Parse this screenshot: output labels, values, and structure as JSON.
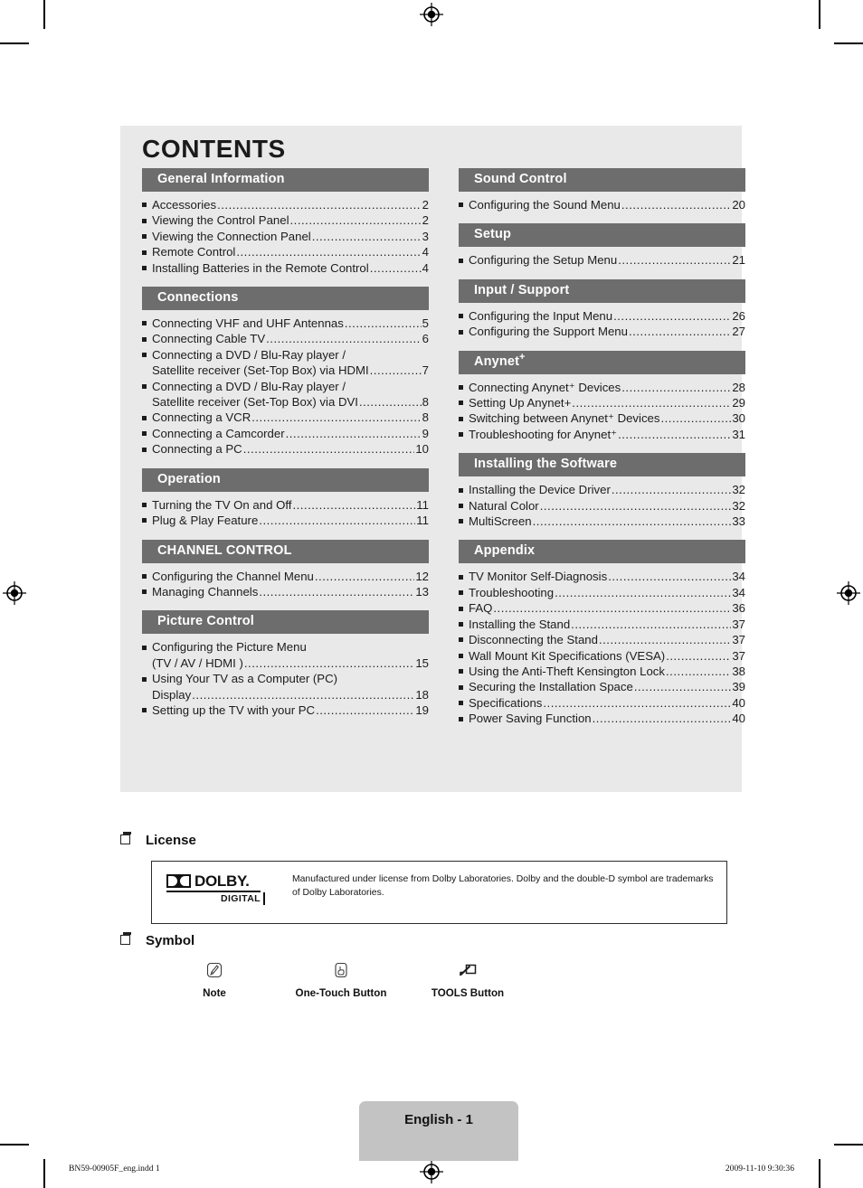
{
  "document": {
    "contents_title": "CONTENTS",
    "page_label": "English - 1",
    "footer_left": "BN59-00905F_eng.indd   1",
    "footer_right": "2009-11-10   9:30:36"
  },
  "colors": {
    "panel_bg": "#e9e9e9",
    "section_bar": "#6d6d6d",
    "section_bar_text": "#ffffff",
    "page_badge": "#c3c3c3",
    "text": "#1c1c1c"
  },
  "toc": {
    "left_column": [
      {
        "heading": "General Information",
        "heading_sup": "",
        "entries": [
          {
            "text": "Accessories",
            "page": "2"
          },
          {
            "text": "Viewing the Control Panel",
            "page": "2"
          },
          {
            "text": "Viewing the Connection Panel",
            "page": "3"
          },
          {
            "text": "Remote Control",
            "page": "4"
          },
          {
            "text": "Installing Batteries in the Remote Control",
            "page": "4"
          }
        ]
      },
      {
        "heading": "Connections",
        "heading_sup": "",
        "entries": [
          {
            "text": "Connecting VHF and UHF Antennas",
            "page": "5"
          },
          {
            "text": "Connecting Cable TV",
            "page": "6"
          },
          {
            "text": "Connecting a DVD / Blu-Ray player /",
            "page": "",
            "nodots": true
          },
          {
            "text": "Satellite receiver (Set-Top Box) via HDMI",
            "page": "7",
            "cont": true
          },
          {
            "text": "Connecting a DVD / Blu-Ray player /",
            "page": "",
            "nodots": true
          },
          {
            "text": "Satellite receiver (Set-Top Box) via DVI",
            "page": "8",
            "cont": true
          },
          {
            "text": "Connecting a VCR",
            "page": "8"
          },
          {
            "text": "Connecting a Camcorder",
            "page": "9"
          },
          {
            "text": "Connecting a PC",
            "page": "10"
          }
        ]
      },
      {
        "heading": "Operation",
        "heading_sup": "",
        "entries": [
          {
            "text": "Turning the TV On and Off",
            "page": "11"
          },
          {
            "text": "Plug & Play Feature",
            "page": "11"
          }
        ]
      },
      {
        "heading": "CHANNEL CONTROL",
        "heading_sup": "",
        "entries": [
          {
            "text": "Configuring the Channel Menu",
            "page": "12"
          },
          {
            "text": "Managing Channels",
            "page": "13"
          }
        ]
      },
      {
        "heading": "Picture Control",
        "heading_sup": "",
        "entries": [
          {
            "text": "Configuring the Picture Menu",
            "page": "",
            "nodots": true
          },
          {
            "text": "(TV / AV / HDMI )",
            "page": "15",
            "cont": true
          },
          {
            "text": "Using Your TV as a Computer (PC)",
            "page": "",
            "nodots": true
          },
          {
            "text": "Display",
            "page": "18",
            "cont": true
          },
          {
            "text": "Setting up the TV with your PC",
            "page": "19"
          }
        ]
      }
    ],
    "right_column": [
      {
        "heading": "Sound Control",
        "heading_sup": "",
        "entries": [
          {
            "text": "Configuring the Sound Menu",
            "page": "20"
          }
        ]
      },
      {
        "heading": "Setup",
        "heading_sup": "",
        "entries": [
          {
            "text": "Configuring the Setup Menu",
            "page": "21"
          }
        ]
      },
      {
        "heading": "Input / Support",
        "heading_sup": "",
        "entries": [
          {
            "text": "Configuring the Input Menu",
            "page": "26"
          },
          {
            "text": "Configuring the Support Menu",
            "page": "27"
          }
        ]
      },
      {
        "heading": "Anynet",
        "heading_sup": "+",
        "entries": [
          {
            "text": "Connecting Anynet⁺ Devices",
            "page": "28"
          },
          {
            "text": "Setting Up Anynet+",
            "page": "29"
          },
          {
            "text": "Switching between Anynet⁺ Devices",
            "page": "30"
          },
          {
            "text": "Troubleshooting for Anynet⁺",
            "page": "31"
          }
        ]
      },
      {
        "heading": "Installing the Software",
        "heading_sup": "",
        "entries": [
          {
            "text": "Installing the Device Driver",
            "page": "32"
          },
          {
            "text": "Natural Color",
            "page": "32"
          },
          {
            "text": "MultiScreen",
            "page": "33"
          }
        ]
      },
      {
        "heading": "Appendix",
        "heading_sup": "",
        "entries": [
          {
            "text": "TV Monitor Self-Diagnosis",
            "page": "34"
          },
          {
            "text": "Troubleshooting",
            "page": "34"
          },
          {
            "text": "FAQ",
            "page": "36"
          },
          {
            "text": "Installing the Stand",
            "page": "37"
          },
          {
            "text": "Disconnecting the Stand",
            "page": "37"
          },
          {
            "text": "Wall Mount Kit Specifications (VESA)",
            "page": "37"
          },
          {
            "text": "Using the Anti-Theft Kensington Lock",
            "page": "38"
          },
          {
            "text": "Securing the Installation Space",
            "page": "39"
          },
          {
            "text": "Specifications",
            "page": "40"
          },
          {
            "text": "Power Saving Function",
            "page": "40"
          }
        ]
      }
    ]
  },
  "license": {
    "heading": "License",
    "logo_word": "DOLBY.",
    "logo_sub": "DIGITAL",
    "text": "Manufactured under license from Dolby Laboratories. Dolby and the double-D symbol are trademarks of Dolby Laboratories."
  },
  "symbol": {
    "heading": "Symbol",
    "items": [
      {
        "icon": "note-icon",
        "label": "Note"
      },
      {
        "icon": "one-touch-button-icon",
        "label": "One-Touch Button"
      },
      {
        "icon": "tools-button-icon",
        "label": "TOOLS Button"
      }
    ]
  }
}
